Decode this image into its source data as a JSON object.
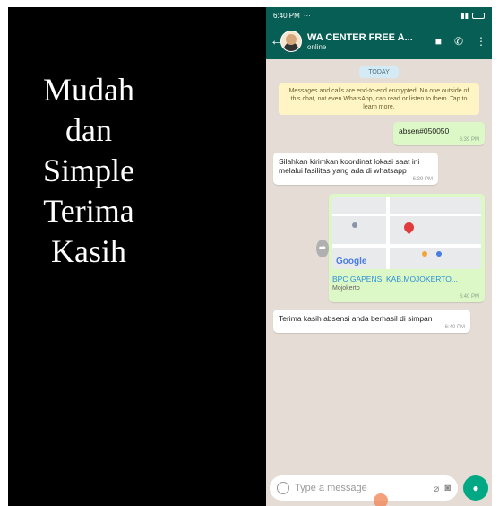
{
  "caption": {
    "lines": [
      "Mudah",
      "dan",
      "Simple",
      "Terima",
      "Kasih"
    ]
  },
  "statusbar": {
    "time": "6:40 PM",
    "dots": "···"
  },
  "chat_header": {
    "contact_name": "WA CENTER FREE A...",
    "status": "online"
  },
  "day_chip": "TODAY",
  "encryption_notice": "Messages and calls are end-to-end encrypted. No one outside of this chat, not even WhatsApp, can read or listen to them. Tap to learn more.",
  "messages": [
    {
      "direction": "out",
      "text": "absen#050050",
      "time": "6:39 PM"
    },
    {
      "direction": "in",
      "text": "Silahkan kirimkan koordinat lokasi saat ini melalui fasilitas yang ada di whatsapp",
      "time": "6:39 PM"
    },
    {
      "direction": "out",
      "type": "location",
      "place": "BPC GAPENSI KAB.MOJOKERTO...",
      "place_sub": "Mojokerto",
      "map_logo": "Google",
      "time": "6:40 PM"
    },
    {
      "direction": "in",
      "text": "Terima kasih absensi anda berhasil di simpan",
      "time": "6:40 PM"
    }
  ],
  "composer": {
    "placeholder": "Type a message"
  },
  "icons": {
    "back": "arrow-left-icon",
    "video": "video-call-icon",
    "call": "phone-icon",
    "menu": "more-vert-icon",
    "emoji": "emoji-icon",
    "attach": "paperclip-icon",
    "camera": "camera-icon",
    "mic": "mic-icon",
    "share": "share-icon"
  },
  "colors": {
    "header": "#075e54",
    "outgoing": "#dcf8c6",
    "incoming": "#ffffff",
    "wallpaper": "#e5ddd5",
    "accent": "#00a884"
  }
}
